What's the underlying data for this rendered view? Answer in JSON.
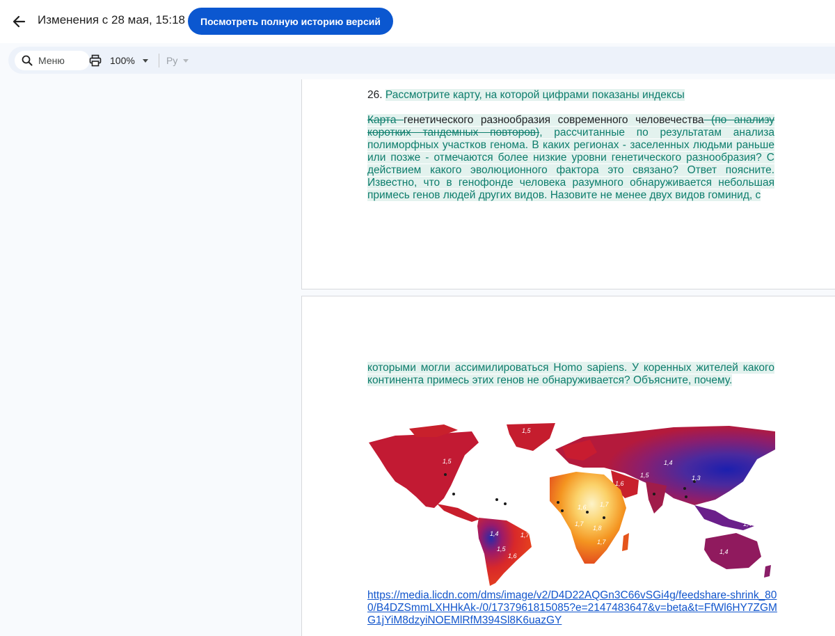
{
  "header": {
    "title": "Изменения с 28 мая, 15:18",
    "history_button": "Посмотреть полную историю версий"
  },
  "toolbar": {
    "menu_label": "Меню",
    "zoom": "100%",
    "language": "Ру"
  },
  "document": {
    "question_number": "26.",
    "question_line": "Рассмотрите карту, на которой цифрами показаны индексы",
    "para1_deleted_start": "Карта ",
    "para1_kept": "генетического разнообразия современного человечества",
    "para1_deleted_end": " (по анализу коротких тандемных повторов)",
    "para1_rest": ", рассчитанные по результатам анализа полиморфных участков генома. В каких регионах - заселенных людьми раньше или позже - отмечаются более низкие уровни генетического разнообразия? С действием какого эволюционного фактора это связано? Ответ поясните. Известно, что в генофонде человека разумного обнаруживается небольшая примесь генов людей других видов. Назовите не менее двух видов гоминид, с",
    "para2": "которыми могли ассимилироваться Homo sapiens. У коренных жителей какого континента примесь этих генов не обнаруживается? Объясните, почему. ",
    "map_labels": [
      "1,5",
      "1,5",
      "1,6",
      "1,4",
      "1,5",
      "1,6",
      "1,7",
      "1,4",
      "1,3",
      "1,6",
      "1,7",
      "1,8",
      "1,7",
      "1,4",
      "1,7",
      "1,6",
      "1,5",
      "1,4"
    ],
    "link": "https://media.licdn.com/dms/image/v2/D4D22AQGn3C66vSGi4g/feedshare-shrink_800/B4DZSmmLXHHkAk-/0/1737961815085?e=2147483647&v=beta&t=FfWl6HY7ZGMG1jYiM8dzyiNOEMlRfM394Sl8K6uazGY"
  }
}
